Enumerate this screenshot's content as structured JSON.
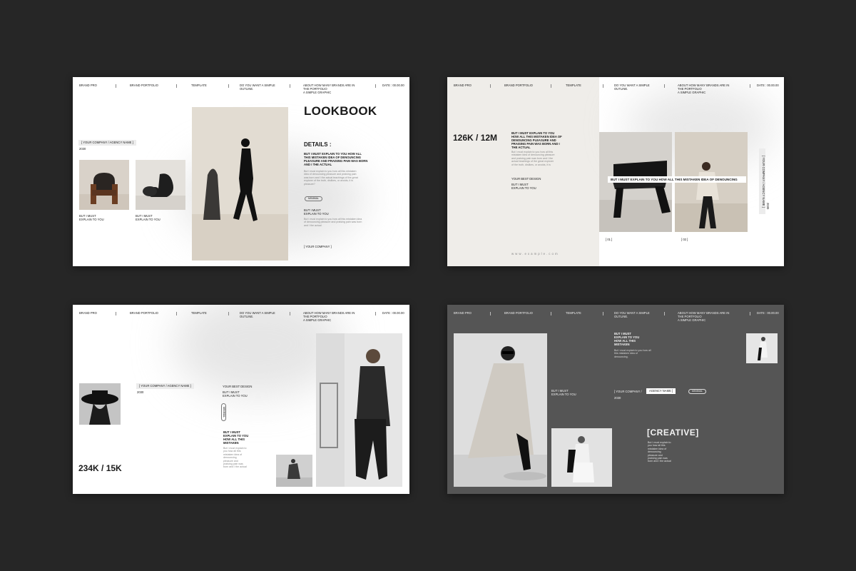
{
  "header": {
    "brand_pro": "BRAND PRO",
    "brand_portfolio": "BRAND PORTFOLIO",
    "template": "TEMPLATE",
    "outline_line1": "DO YOU WANT A SIMPLE",
    "outline_line2": "OUTLINE.",
    "about_line1": "ABOUT HOW MANY BRANDS ARE IN",
    "about_line2": "THE PORTFOLIO",
    "about_line3": "A SIMPLE GRAPHIC",
    "date": "DATE : 00.00.00"
  },
  "slide1": {
    "company_chip": "[ YOUR COMPANY / AGENCY NAME ]",
    "year": "2030",
    "title": "LOOKBOOK",
    "details_heading": "DETAILS :",
    "details_bold_1": "BUT I MUST EXPLAIN TO YOU HOW ALL",
    "details_bold_2": "THIS MISTAKEN IDEA OF DENOUNCING",
    "details_bold_3": "PLEASURE AND PRAISING PAIN WAS BORN",
    "details_bold_4": "AND I THE ACTUAL",
    "details_body_1": "But I must explain to you how all this mistaken",
    "details_body_2": "idea of denouncing pleasure and praising pain",
    "details_body_3": "was born and I the actual teachings of the great",
    "details_body_4": "explorer of the truth, dislikes, or avoids, it is",
    "details_body_5": "pleasure?",
    "pill": "MINIMAL",
    "caption_1": "BUT I MUST",
    "caption_2": "EXPLAIN TO YOU",
    "small_body_1": "But I must explain to you how all this mistaken idea",
    "small_body_2": "of denouncing pleasure and praising pain was born",
    "small_body_3": "and I the actual",
    "footer_company": "[ YOUR COMPANY ]",
    "chair_caption_a1": "BUT I MUST",
    "chair_caption_a2": "EXPLAIN TO YOU",
    "chair_caption_b1": "BUT I MUST",
    "chair_caption_b2": "EXPLAIN TO YOU"
  },
  "slide2": {
    "stat": "126K / 12M",
    "bold_1": "BUT I MUST EXPLAIN TO YOU",
    "bold_2": "HOW ALL THIS MISTAKEN IDEA OF",
    "bold_3": "DENOUNCING PLEASURE AND",
    "bold_4": "PRAISING PAIN WAS BORN AND I",
    "bold_5": "THE ACTUAL",
    "body_1": "But I must explain to you how all this",
    "body_2": "mistaken idea of denouncing pleasure",
    "body_3": "and praising pain was born and I the",
    "body_4": "actual teachings of the great explorer",
    "body_5": "of the truth, dislikes, or avoids, it is",
    "design": "YOUR BEST DESIGN",
    "caption_1": "BUT I MUST",
    "caption_2": "EXPLAIN TO YOU",
    "banner": "BUT I MUST EXPLAIN TO YOU HOW ALL THIS MISTAKEN IDEA OF DENOUNCING",
    "label_01": "[ 01 ]",
    "label_02": "[ 02 ]",
    "url": "www.example.com",
    "vertical_company": "[ YOUR COMPANY / AGENCY NAME ]",
    "vertical_year": "2030"
  },
  "slide3": {
    "stat": "234K / 15K",
    "company_chip": "[ YOUR COMPANY / AGENCY NAME ]",
    "year": "2030",
    "design": "YOUR BEST DESIGN",
    "caption_1": "BUT I MUST",
    "caption_2": "EXPLAIN TO YOU",
    "pill": "MINIMAL",
    "bold_1": "BUT I MUST",
    "bold_2": "EXPLAIN TO YOU",
    "bold_3": "HOW ALL THIS",
    "bold_4": "MISTAKEN",
    "body_1": "But I must explain to",
    "body_2": "you how all this",
    "body_3": "mistaken idea of",
    "body_4": "denouncing",
    "body_5": "pleasure and",
    "body_6": "praising pain was",
    "body_7": "born and I the actual"
  },
  "slide4": {
    "bold_1": "BUT I MUST",
    "bold_2": "EXPLAIN TO YOU",
    "bold_3": "HOW ALL THIS",
    "bold_4": "MISTAKEN",
    "body_1": "But I must explain to you how all",
    "body_2": "this mistaken idea of",
    "body_3": "denouncing.",
    "caption_1": "BUT I MUST",
    "caption_2": "EXPLAIN TO YOU",
    "company_prefix": "[ YOUR COMPANY /",
    "company_chip": "AGENCY NAME ]",
    "year": "2030",
    "pill": "MINIMAL",
    "creative": "[CREATIVE]",
    "creative_body_1": "But I must explain to",
    "creative_body_2": "you how all this",
    "creative_body_3": "mistaken idea of",
    "creative_body_4": "denouncing",
    "creative_body_5": "pleasure and",
    "creative_body_6": "praising pain was",
    "creative_body_7": "born and I the actual"
  },
  "colors": {
    "background": "#262626",
    "slide_light": "#ffffff",
    "slide_dark": "#555555"
  }
}
